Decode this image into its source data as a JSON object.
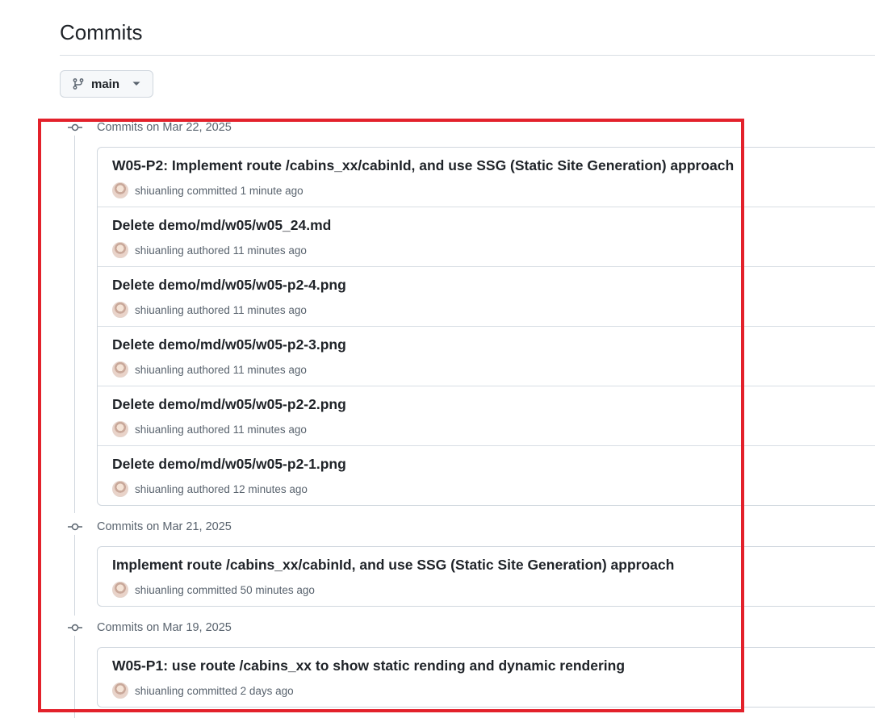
{
  "page": {
    "title": "Commits"
  },
  "branch": {
    "label": "main"
  },
  "groups": [
    {
      "date": "Commits on Mar 22, 2025",
      "commits": [
        {
          "message": "W05-P2: Implement route /cabins_xx/cabinId, and use SSG (Static Site Generation) approach",
          "author": "shiuanling",
          "action": "committed",
          "time": "1 minute ago"
        },
        {
          "message": "Delete demo/md/w05/w05_24.md",
          "author": "shiuanling",
          "action": "authored",
          "time": "11 minutes ago"
        },
        {
          "message": "Delete demo/md/w05/w05-p2-4.png",
          "author": "shiuanling",
          "action": "authored",
          "time": "11 minutes ago"
        },
        {
          "message": "Delete demo/md/w05/w05-p2-3.png",
          "author": "shiuanling",
          "action": "authored",
          "time": "11 minutes ago"
        },
        {
          "message": "Delete demo/md/w05/w05-p2-2.png",
          "author": "shiuanling",
          "action": "authored",
          "time": "11 minutes ago"
        },
        {
          "message": "Delete demo/md/w05/w05-p2-1.png",
          "author": "shiuanling",
          "action": "authored",
          "time": "12 minutes ago"
        }
      ]
    },
    {
      "date": "Commits on Mar 21, 2025",
      "commits": [
        {
          "message": "Implement route /cabins_xx/cabinId, and use SSG (Static Site Generation) approach",
          "author": "shiuanling",
          "action": "committed",
          "time": "50 minutes ago"
        }
      ]
    },
    {
      "date": "Commits on Mar 19, 2025",
      "commits": [
        {
          "message": "W05-P1: use route /cabins_xx to show static rending and dynamic rendering",
          "author": "shiuanling",
          "action": "committed",
          "time": "2 days ago"
        }
      ]
    }
  ],
  "colors": {
    "highlight": "#e3212b",
    "border": "#d0d7de",
    "muted": "#59636e",
    "text": "#1f2328"
  },
  "icons": {
    "branch": "git-branch-icon",
    "caret": "caret-down-icon",
    "commit": "git-commit-icon"
  }
}
